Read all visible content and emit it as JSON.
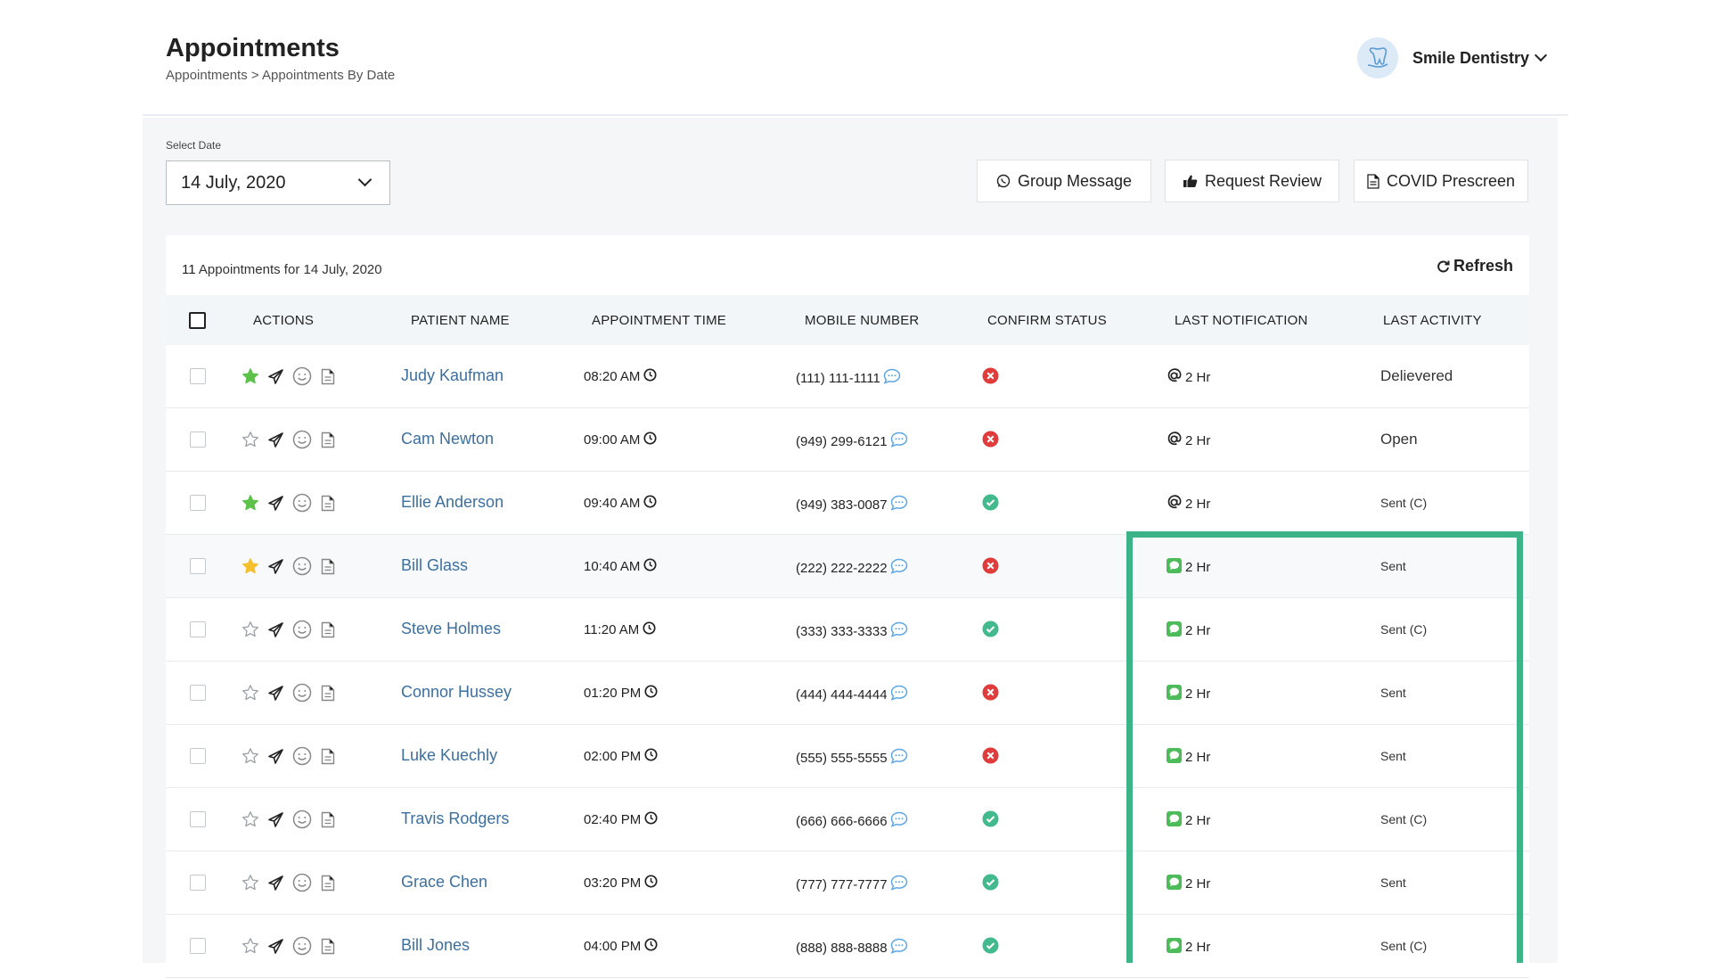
{
  "header": {
    "title": "Appointments",
    "breadcrumb": "Appointments > Appointments By Date",
    "practice_name": "Smile Dentistry"
  },
  "toolbar": {
    "date_label": "Select Date",
    "date_value": "14 July, 2020",
    "group_message": "Group Message",
    "request_review": "Request Review",
    "covid_prescreen": "COVID Prescreen"
  },
  "summary": {
    "count": "11",
    "text": "Appointments for 14 July, 2020",
    "refresh": "Refresh"
  },
  "columns": {
    "actions": "ACTIONS",
    "patient": "PATIENT NAME",
    "time": "APPOINTMENT TIME",
    "mobile": "MOBILE NUMBER",
    "confirm": "CONFIRM STATUS",
    "notification": "LAST NOTIFICATION",
    "activity": "LAST ACTIVITY"
  },
  "colors": {
    "accent_green": "#3db487",
    "link_blue": "#3c6f9e",
    "confirmed": "#43b98e",
    "unconfirmed": "#e03c3c"
  },
  "rows": [
    {
      "star": "green",
      "name": "Judy Kaufman",
      "time": "08:20 AM",
      "phone": "(111) 111-1111",
      "confirmed": false,
      "notif_type": "email",
      "notif": "2 Hr",
      "activity": "Delievered"
    },
    {
      "star": "empty",
      "name": "Cam Newton",
      "time": "09:00 AM",
      "phone": "(949) 299-6121",
      "confirmed": false,
      "notif_type": "email",
      "notif": "2 Hr",
      "activity": "Open"
    },
    {
      "star": "green",
      "name": "Ellie Anderson",
      "time": "09:40 AM",
      "phone": "(949) 383-0087",
      "confirmed": true,
      "notif_type": "email",
      "notif": "2 Hr",
      "activity": "Sent (C)"
    },
    {
      "star": "yellow",
      "name": "Bill Glass",
      "time": "10:40 AM",
      "phone": "(222) 222-2222",
      "confirmed": false,
      "notif_type": "sms",
      "notif": "2 Hr",
      "activity": "Sent"
    },
    {
      "star": "empty",
      "name": "Steve Holmes",
      "time": "11:20 AM",
      "phone": "(333) 333-3333",
      "confirmed": true,
      "notif_type": "sms",
      "notif": "2 Hr",
      "activity": "Sent (C)"
    },
    {
      "star": "empty",
      "name": "Connor Hussey",
      "time": "01:20 PM",
      "phone": "(444) 444-4444",
      "confirmed": false,
      "notif_type": "sms",
      "notif": "2 Hr",
      "activity": "Sent"
    },
    {
      "star": "empty",
      "name": "Luke Kuechly",
      "time": "02:00 PM",
      "phone": "(555) 555-5555",
      "confirmed": false,
      "notif_type": "sms",
      "notif": "2 Hr",
      "activity": "Sent"
    },
    {
      "star": "empty",
      "name": "Travis Rodgers",
      "time": "02:40 PM",
      "phone": "(666) 666-6666",
      "confirmed": true,
      "notif_type": "sms",
      "notif": "2 Hr",
      "activity": "Sent (C)"
    },
    {
      "star": "empty",
      "name": "Grace Chen",
      "time": "03:20 PM",
      "phone": "(777) 777-7777",
      "confirmed": true,
      "notif_type": "sms",
      "notif": "2 Hr",
      "activity": "Sent"
    },
    {
      "star": "empty",
      "name": "Bill Jones",
      "time": "04:00 PM",
      "phone": "(888) 888-8888",
      "confirmed": true,
      "notif_type": "sms",
      "notif": "2 Hr",
      "activity": "Sent (C)"
    }
  ]
}
